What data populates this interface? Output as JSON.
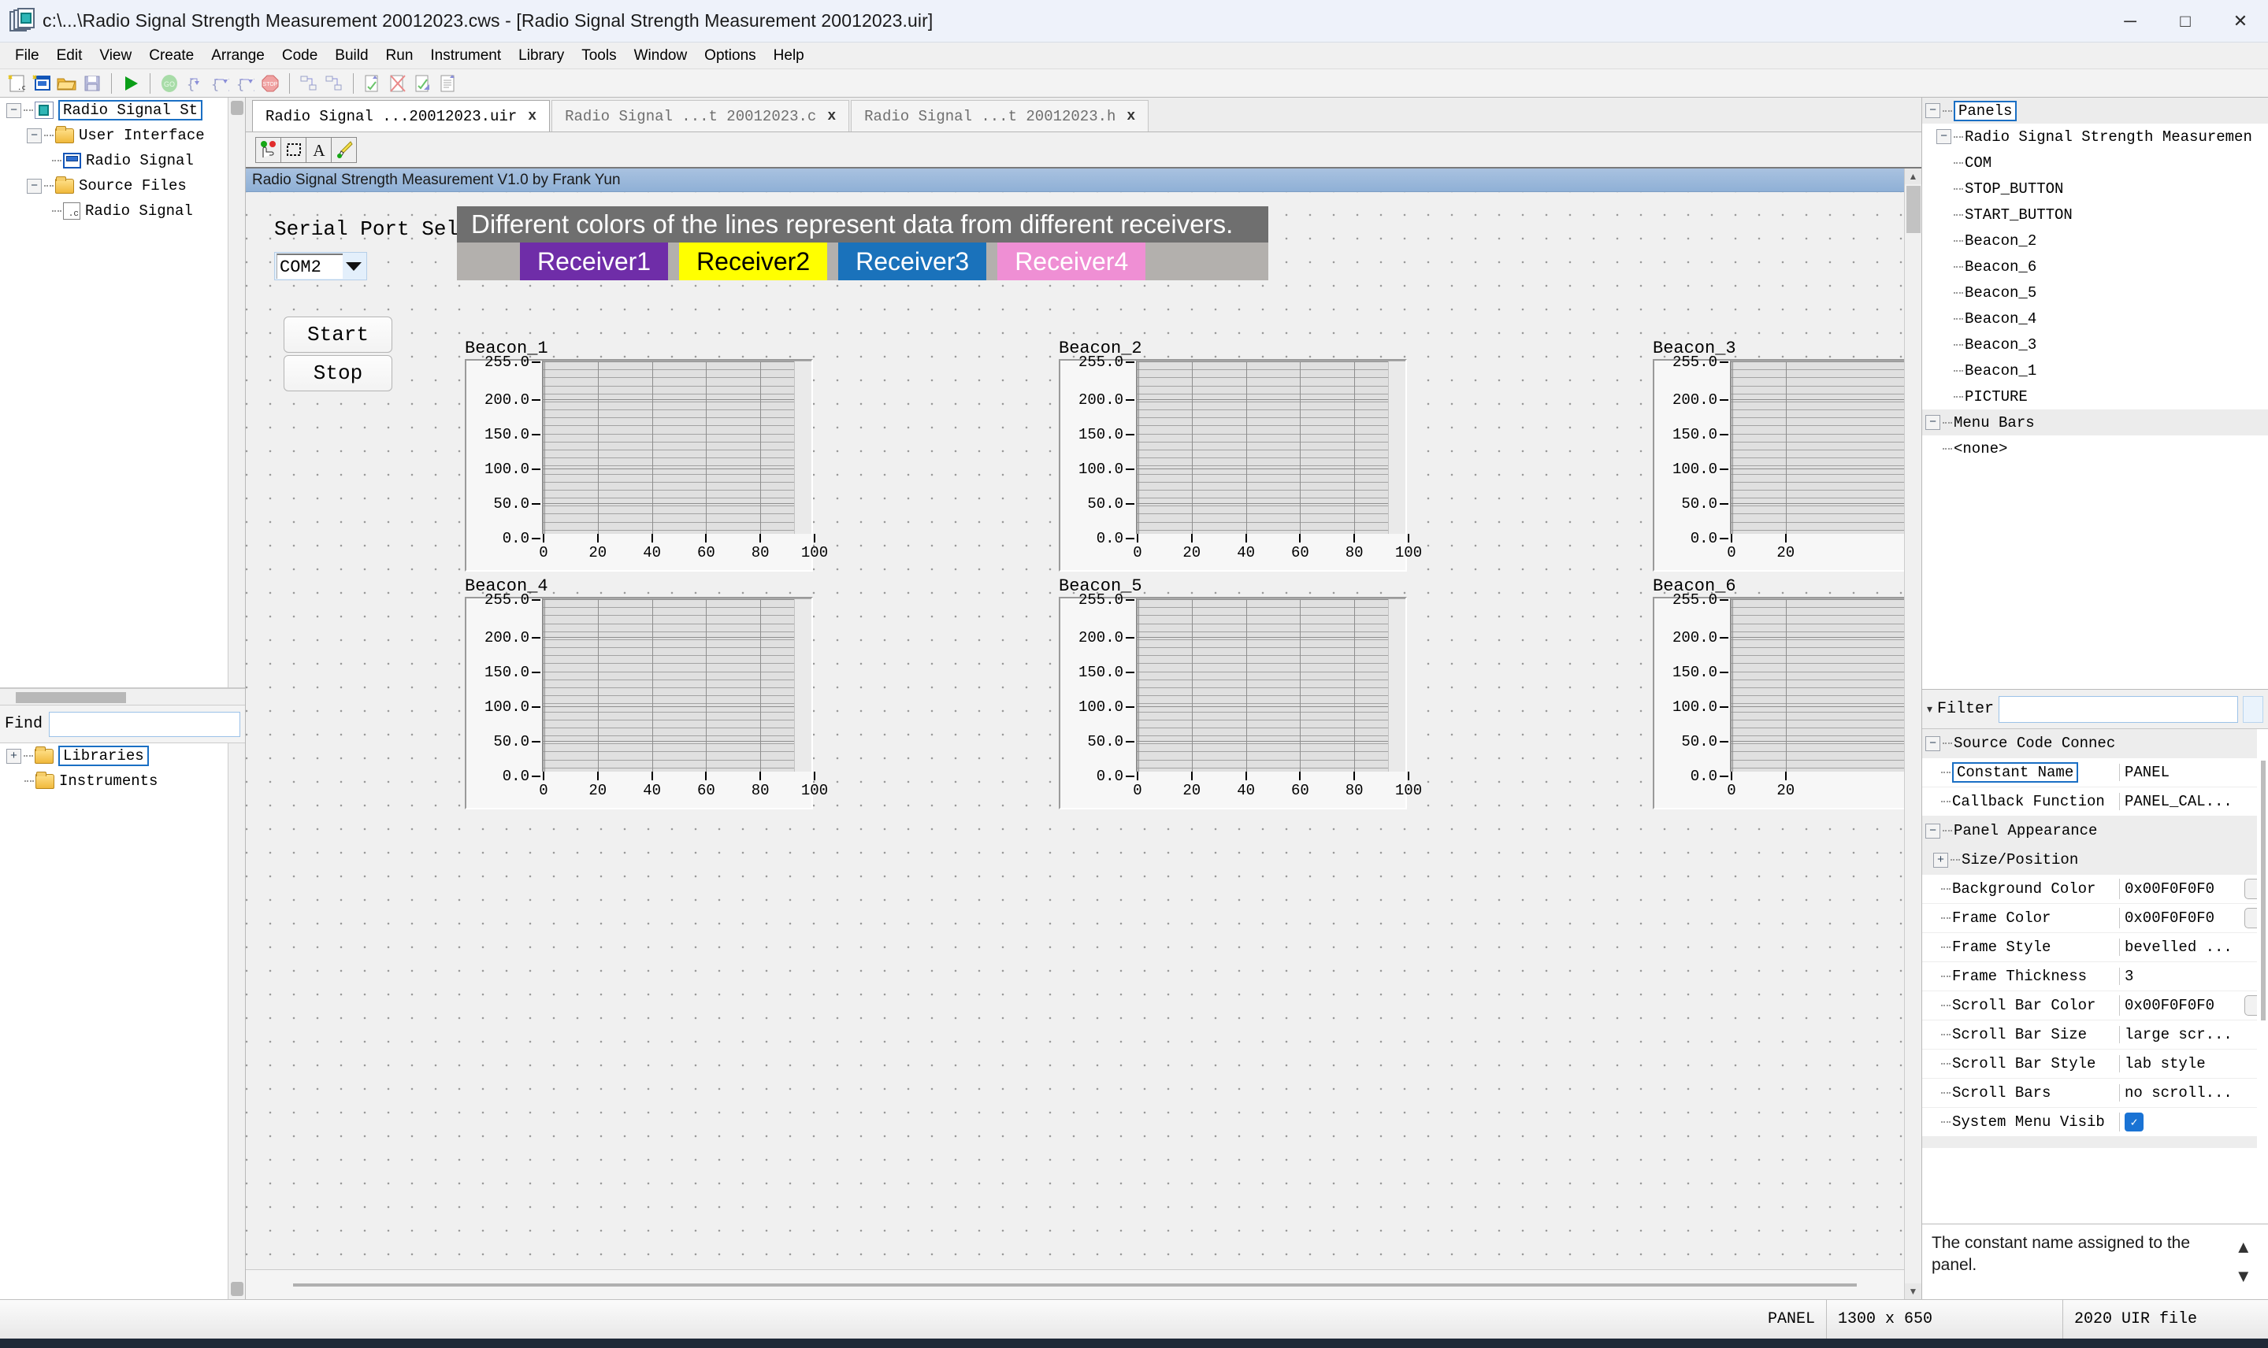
{
  "window": {
    "title": "c:\\...\\Radio Signal Strength Measurement 20012023.cws - [Radio Signal Strength Measurement 20012023.uir]",
    "icon": "cvi-workspace-icon",
    "minimize": "─",
    "maximize": "□",
    "close": "✕"
  },
  "menubar": {
    "items": [
      {
        "label": "File",
        "accel": "F"
      },
      {
        "label": "Edit",
        "accel": "E"
      },
      {
        "label": "View",
        "accel": "V"
      },
      {
        "label": "Create",
        "accel": "C"
      },
      {
        "label": "Arrange",
        "accel": "A"
      },
      {
        "label": "Code",
        "accel": "d"
      },
      {
        "label": "Build",
        "accel": "B"
      },
      {
        "label": "Run",
        "accel": "R"
      },
      {
        "label": "Instrument",
        "accel": "I"
      },
      {
        "label": "Library",
        "accel": "L"
      },
      {
        "label": "Tools",
        "accel": "T"
      },
      {
        "label": "Window",
        "accel": "W"
      },
      {
        "label": "Options",
        "accel": "O"
      },
      {
        "label": "Help",
        "accel": "H"
      }
    ]
  },
  "toolbar": {
    "buttons": [
      {
        "name": "new-source-file-icon"
      },
      {
        "name": "new-uir-file-icon"
      },
      {
        "name": "open-folder-icon"
      },
      {
        "name": "save-icon"
      },
      {
        "name": "run-project-icon"
      },
      {
        "name": "go-debug-icon"
      },
      {
        "name": "step-into-icon"
      },
      {
        "name": "step-over-icon"
      },
      {
        "name": "step-out-icon"
      },
      {
        "name": "terminate-stop-icon"
      },
      {
        "name": "view-hierarchy-icon"
      },
      {
        "name": "view-call-stack-icon"
      },
      {
        "name": "build-icon"
      },
      {
        "name": "clear-errors-icon"
      },
      {
        "name": "check-syntax-icon"
      },
      {
        "name": "insert-construct-icon"
      }
    ]
  },
  "project_tree": {
    "nodes": [
      {
        "label": "Radio Signal St",
        "icon": "workspace-icon",
        "depth": 0,
        "expander": "−",
        "selected": true
      },
      {
        "label": "User Interface",
        "icon": "folder-icon",
        "depth": 1,
        "expander": "−",
        "selected": false
      },
      {
        "label": "Radio Signal",
        "icon": "uir-file-icon",
        "depth": 2,
        "expander": "",
        "selected": false
      },
      {
        "label": "Source Files",
        "icon": "folder-icon",
        "depth": 1,
        "expander": "−",
        "selected": false
      },
      {
        "label": "Radio Signal",
        "icon": "c-file-icon",
        "depth": 2,
        "expander": "",
        "selected": false
      }
    ]
  },
  "find": {
    "label": "Find",
    "value": "",
    "placeholder": "",
    "funnel_icon": "filter-funnel-icon",
    "items": [
      {
        "label": "Libraries",
        "icon": "folder-icon",
        "expander": "+",
        "selected": true
      },
      {
        "label": "Instruments",
        "icon": "folder-icon",
        "expander": "",
        "selected": false
      }
    ]
  },
  "tabs": [
    {
      "label": "Radio Signal ...20012023.uir",
      "close": "x",
      "active": true
    },
    {
      "label": "Radio Signal ...t 20012023.c",
      "close": "x",
      "active": false
    },
    {
      "label": "Radio Signal ...t 20012023.h",
      "close": "x",
      "active": false
    }
  ],
  "panel_toolbar": {
    "buttons": [
      {
        "name": "operate-mode-icon"
      },
      {
        "name": "select-rectangle-icon"
      },
      {
        "name": "text-tool-icon"
      },
      {
        "name": "color-brush-icon"
      }
    ]
  },
  "uir_panel": {
    "caption": "Radio Signal Strength Measurement V1.0 by Frank Yun",
    "serial_label": "Serial Port Selection",
    "com_value": "COM2",
    "com_caret_icon": "chevron-down-icon",
    "start_button": "Start",
    "stop_button": "Stop",
    "banner": "Different colors of the lines represent data from different receivers.",
    "banner_bg": "#6f6f6f",
    "legend_bg": "#b3b0ad",
    "receivers": [
      {
        "label": "Receiver1",
        "bg": "#6f2da8",
        "fg": "#ffffff"
      },
      {
        "label": "Receiver2",
        "bg": "#ffff00",
        "fg": "#000000"
      },
      {
        "label": "Receiver3",
        "bg": "#1a72bb",
        "fg": "#ffffff"
      },
      {
        "label": "Receiver4",
        "bg": "#ef8fd4",
        "fg": "#ffffff"
      }
    ]
  },
  "chart_data": [
    {
      "type": "line",
      "title": "Beacon_1",
      "x": [],
      "series": [],
      "xlabel": "",
      "ylabel": "",
      "xlim": [
        0,
        100
      ],
      "ylim": [
        0,
        255
      ],
      "xticks": [
        0,
        20,
        40,
        60,
        80,
        100
      ],
      "yticks": [
        0.0,
        50.0,
        100.0,
        150.0,
        200.0,
        255.0
      ],
      "xticklabels": [
        "0",
        "20",
        "40",
        "60",
        "80",
        "100"
      ],
      "yticklabels": [
        "0.0",
        "50.0",
        "100.0",
        "150.0",
        "200.0",
        "255.0"
      ],
      "grid": true,
      "legend": "none"
    },
    {
      "type": "line",
      "title": "Beacon_2",
      "x": [],
      "series": [],
      "xlabel": "",
      "ylabel": "",
      "xlim": [
        0,
        100
      ],
      "ylim": [
        0,
        255
      ],
      "xticks": [
        0,
        20,
        40,
        60,
        80,
        100
      ],
      "yticks": [
        0.0,
        50.0,
        100.0,
        150.0,
        200.0,
        255.0
      ],
      "xticklabels": [
        "0",
        "20",
        "40",
        "60",
        "80",
        "100"
      ],
      "yticklabels": [
        "0.0",
        "50.0",
        "100.0",
        "150.0",
        "200.0",
        "255.0"
      ],
      "grid": true,
      "legend": "none"
    },
    {
      "type": "line",
      "title": "Beacon_3",
      "x": [],
      "series": [],
      "xlabel": "",
      "ylabel": "",
      "xlim": [
        0,
        100
      ],
      "ylim": [
        0,
        255
      ],
      "xticks": [
        0,
        20
      ],
      "yticks": [
        0.0,
        50.0,
        100.0,
        150.0,
        200.0,
        255.0
      ],
      "xticklabels": [
        "0",
        "20"
      ],
      "yticklabels": [
        "0.0",
        "50.0",
        "100.0",
        "150.0",
        "200.0",
        "255.0"
      ],
      "grid": true,
      "legend": "none",
      "clipped": true
    },
    {
      "type": "line",
      "title": "Beacon_4",
      "x": [],
      "series": [],
      "xlabel": "",
      "ylabel": "",
      "xlim": [
        0,
        100
      ],
      "ylim": [
        0,
        255
      ],
      "xticks": [
        0,
        20,
        40,
        60,
        80,
        100
      ],
      "yticks": [
        0.0,
        50.0,
        100.0,
        150.0,
        200.0,
        255.0
      ],
      "xticklabels": [
        "0",
        "20",
        "40",
        "60",
        "80",
        "100"
      ],
      "yticklabels": [
        "0.0",
        "50.0",
        "100.0",
        "150.0",
        "200.0",
        "255.0"
      ],
      "grid": true,
      "legend": "none"
    },
    {
      "type": "line",
      "title": "Beacon_5",
      "x": [],
      "series": [],
      "xlabel": "",
      "ylabel": "",
      "xlim": [
        0,
        100
      ],
      "ylim": [
        0,
        255
      ],
      "xticks": [
        0,
        20,
        40,
        60,
        80,
        100
      ],
      "yticks": [
        0.0,
        50.0,
        100.0,
        150.0,
        200.0,
        255.0
      ],
      "xticklabels": [
        "0",
        "20",
        "40",
        "60",
        "80",
        "100"
      ],
      "yticklabels": [
        "0.0",
        "50.0",
        "100.0",
        "150.0",
        "200.0",
        "255.0"
      ],
      "grid": true,
      "legend": "none"
    },
    {
      "type": "line",
      "title": "Beacon_6",
      "x": [],
      "series": [],
      "xlabel": "",
      "ylabel": "",
      "xlim": [
        0,
        100
      ],
      "ylim": [
        0,
        255
      ],
      "xticks": [
        0,
        20
      ],
      "yticks": [
        0.0,
        50.0,
        100.0,
        150.0,
        200.0,
        255.0
      ],
      "xticklabels": [
        "0",
        "20"
      ],
      "yticklabels": [
        "0.0",
        "50.0",
        "100.0",
        "150.0",
        "200.0",
        "255.0"
      ],
      "grid": true,
      "legend": "none",
      "clipped": true
    }
  ],
  "panels_tree": {
    "nodes": [
      {
        "label": "Panels",
        "depth": 0,
        "expander": "−",
        "selected": true
      },
      {
        "label": "Radio Signal Strength Measuremen",
        "depth": 1,
        "expander": "−",
        "selected": false
      },
      {
        "label": "COM",
        "depth": 2,
        "expander": "",
        "selected": false
      },
      {
        "label": "STOP_BUTTON",
        "depth": 2,
        "expander": "",
        "selected": false
      },
      {
        "label": "START_BUTTON",
        "depth": 2,
        "expander": "",
        "selected": false
      },
      {
        "label": "Beacon_2",
        "depth": 2,
        "expander": "",
        "selected": false
      },
      {
        "label": "Beacon_6",
        "depth": 2,
        "expander": "",
        "selected": false
      },
      {
        "label": "Beacon_5",
        "depth": 2,
        "expander": "",
        "selected": false
      },
      {
        "label": "Beacon_4",
        "depth": 2,
        "expander": "",
        "selected": false
      },
      {
        "label": "Beacon_3",
        "depth": 2,
        "expander": "",
        "selected": false
      },
      {
        "label": "Beacon_1",
        "depth": 2,
        "expander": "",
        "selected": false
      },
      {
        "label": "PICTURE",
        "depth": 2,
        "expander": "",
        "selected": false
      },
      {
        "label": "Menu Bars",
        "depth": 0,
        "expander": "−",
        "selected": false
      },
      {
        "label": "<none>",
        "depth": 1,
        "expander": "",
        "selected": false
      }
    ]
  },
  "properties": {
    "filter_label": "Filter",
    "filter_value": "",
    "filter_caret_icon": "chevron-down-icon",
    "filter_funnel_icon": "filter-funnel-icon",
    "rows": [
      {
        "name": "Source Code Connec",
        "value": "",
        "kind": "group",
        "expander": "−",
        "depth": 0
      },
      {
        "name": "Constant Name",
        "value": "PANEL",
        "kind": "row",
        "depth": 1,
        "selected": true
      },
      {
        "name": "Callback Function",
        "value": "PANEL_CAL...",
        "kind": "row",
        "depth": 1
      },
      {
        "name": "Panel Appearance",
        "value": "",
        "kind": "group",
        "expander": "−",
        "depth": 0
      },
      {
        "name": "Size/Position",
        "value": "",
        "kind": "subgroup",
        "expander": "+",
        "depth": 1
      },
      {
        "name": "Background Color",
        "value": "0x00F0F0F0",
        "kind": "color",
        "depth": 1
      },
      {
        "name": "Frame Color",
        "value": "0x00F0F0F0",
        "kind": "color",
        "depth": 1
      },
      {
        "name": "Frame Style",
        "value": "bevelled ...",
        "kind": "row",
        "depth": 1
      },
      {
        "name": "Frame Thickness",
        "value": "3",
        "kind": "row",
        "depth": 1
      },
      {
        "name": "Scroll Bar Color",
        "value": "0x00F0F0F0",
        "kind": "color",
        "depth": 1
      },
      {
        "name": "Scroll Bar Size",
        "value": "large scr...",
        "kind": "row",
        "depth": 1
      },
      {
        "name": "Scroll Bar Style",
        "value": "lab style",
        "kind": "row",
        "depth": 1
      },
      {
        "name": "Scroll Bars",
        "value": "no scroll...",
        "kind": "row",
        "depth": 1
      },
      {
        "name": "System Menu Visib",
        "value": "",
        "kind": "checkbox",
        "checked": true,
        "depth": 1
      }
    ],
    "help_text": "The constant name assigned to the panel.",
    "help_up_icon": "chevron-up-icon",
    "help_down_icon": "chevron-down-icon"
  },
  "statusbar": {
    "panel_name": "PANEL",
    "panel_size": "1300 x 650",
    "file_version": "2020 UIR file"
  }
}
